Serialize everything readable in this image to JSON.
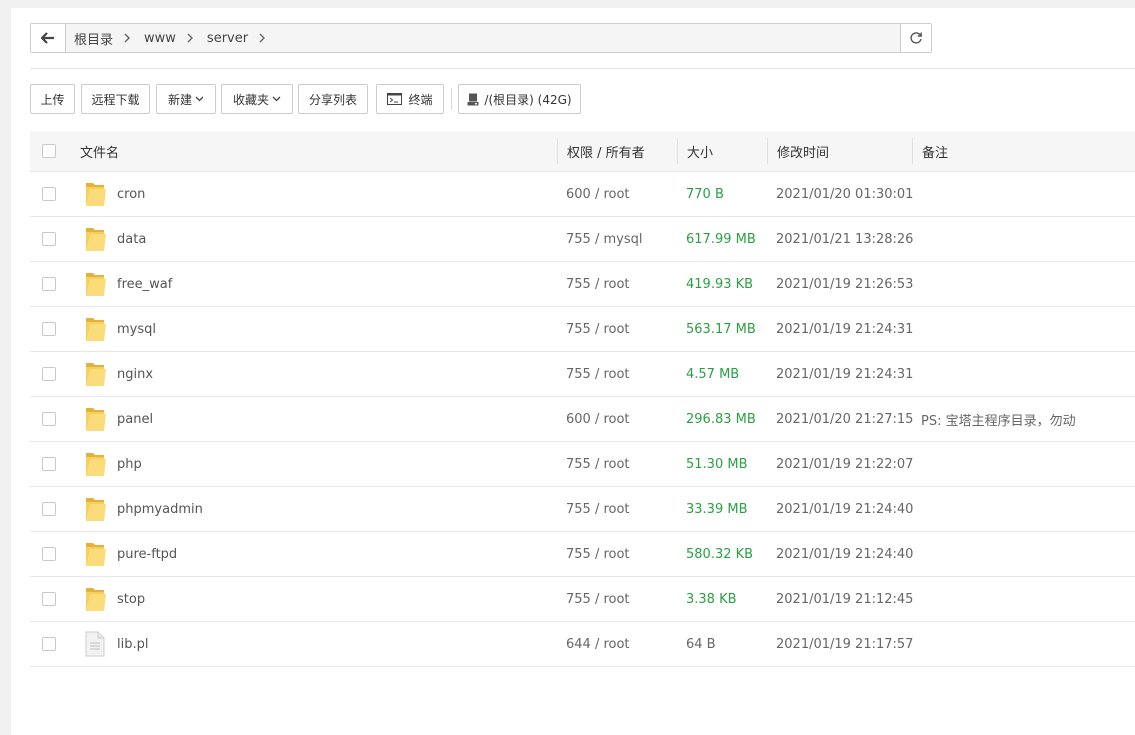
{
  "path": {
    "crumbs": [
      "根目录",
      "www",
      "server"
    ]
  },
  "toolbar": {
    "upload": "上传",
    "remote_download": "远程下载",
    "new": "新建",
    "favorites": "收藏夹",
    "share_list": "分享列表",
    "terminal": "终端",
    "disk": "/(根目录) (42G)"
  },
  "table": {
    "headers": {
      "name": "文件名",
      "perm": "权限 / 所有者",
      "size": "大小",
      "mtime": "修改时间",
      "note": "备注"
    },
    "rows": [
      {
        "name": "cron",
        "type": "folder",
        "perm": "600 / root",
        "size": "770 B",
        "mtime": "2021/01/20 01:30:01",
        "note": ""
      },
      {
        "name": "data",
        "type": "folder",
        "perm": "755 / mysql",
        "size": "617.99 MB",
        "mtime": "2021/01/21 13:28:26",
        "note": ""
      },
      {
        "name": "free_waf",
        "type": "folder",
        "perm": "755 / root",
        "size": "419.93 KB",
        "mtime": "2021/01/19 21:26:53",
        "note": ""
      },
      {
        "name": "mysql",
        "type": "folder",
        "perm": "755 / root",
        "size": "563.17 MB",
        "mtime": "2021/01/19 21:24:31",
        "note": ""
      },
      {
        "name": "nginx",
        "type": "folder",
        "perm": "755 / root",
        "size": "4.57 MB",
        "mtime": "2021/01/19 21:24:31",
        "note": ""
      },
      {
        "name": "panel",
        "type": "folder",
        "perm": "600 / root",
        "size": "296.83 MB",
        "mtime": "2021/01/20 21:27:15",
        "note": "PS: 宝塔主程序目录，勿动"
      },
      {
        "name": "php",
        "type": "folder",
        "perm": "755 / root",
        "size": "51.30 MB",
        "mtime": "2021/01/19 21:22:07",
        "note": ""
      },
      {
        "name": "phpmyadmin",
        "type": "folder",
        "perm": "755 / root",
        "size": "33.39 MB",
        "mtime": "2021/01/19 21:24:40",
        "note": ""
      },
      {
        "name": "pure-ftpd",
        "type": "folder",
        "perm": "755 / root",
        "size": "580.32 KB",
        "mtime": "2021/01/19 21:24:40",
        "note": ""
      },
      {
        "name": "stop",
        "type": "folder",
        "perm": "755 / root",
        "size": "3.38 KB",
        "mtime": "2021/01/19 21:12:45",
        "note": ""
      },
      {
        "name": "lib.pl",
        "type": "file",
        "perm": "644 / root",
        "size": "64 B",
        "mtime": "2021/01/19 21:17:57",
        "note": ""
      }
    ]
  },
  "colors": {
    "size_green": "#2aa043",
    "folder_yellow": "#f7cf5c"
  }
}
